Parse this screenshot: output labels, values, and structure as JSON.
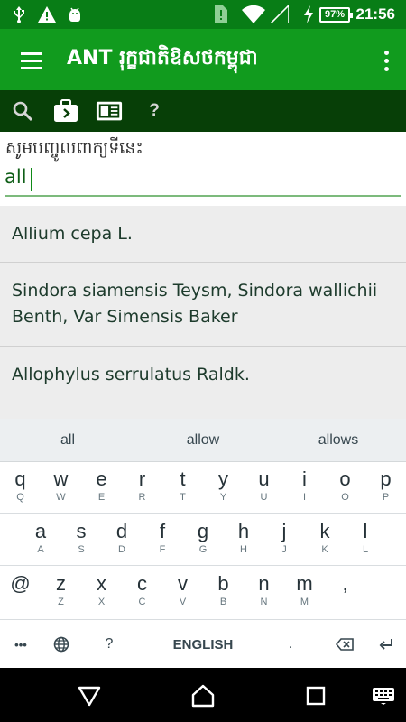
{
  "status_bar": {
    "icons": [
      "usb-icon",
      "warning-icon",
      "android-debug-icon",
      "sim-alert-icon",
      "wifi-icon",
      "cell-signal-icon",
      "charging-icon"
    ],
    "battery": "97%",
    "time": "21:56"
  },
  "app_bar": {
    "title": "ANT រុក្ខជាតិឱសថកម្ពុជា",
    "menu_icon": "hamburger-menu-icon",
    "overflow_icon": "more-vertical-icon"
  },
  "toolbar": {
    "items": [
      "search-icon",
      "briefcase-icon",
      "book-icon"
    ],
    "help_label": "?"
  },
  "search": {
    "prompt": "សូមបញ្ចូលពាក្យទីនេះ",
    "value": "all"
  },
  "results": [
    "Allium cepa L.",
    "Sindora siamensis Teysm, Sindora wallichii Benth, Var Simensis Baker",
    "Allophylus serrulatus Raldk."
  ],
  "keyboard": {
    "suggestions": [
      "all",
      "allow",
      "allows"
    ],
    "rows": [
      [
        [
          "q",
          "Q"
        ],
        [
          "w",
          "W"
        ],
        [
          "e",
          "E"
        ],
        [
          "r",
          "R"
        ],
        [
          "t",
          "T"
        ],
        [
          "y",
          "Y"
        ],
        [
          "u",
          "U"
        ],
        [
          "i",
          "I"
        ],
        [
          "o",
          "O"
        ],
        [
          "p",
          "P"
        ]
      ],
      [
        [
          "a",
          "A"
        ],
        [
          "s",
          "S"
        ],
        [
          "d",
          "D"
        ],
        [
          "f",
          "F"
        ],
        [
          "g",
          "G"
        ],
        [
          "h",
          "H"
        ],
        [
          "j",
          "J"
        ],
        [
          "k",
          "K"
        ],
        [
          "l",
          "L"
        ]
      ],
      [
        [
          "@",
          ""
        ],
        [
          "z",
          "Z"
        ],
        [
          "x",
          "X"
        ],
        [
          "c",
          "C"
        ],
        [
          "v",
          "V"
        ],
        [
          "b",
          "B"
        ],
        [
          "n",
          "N"
        ],
        [
          "m",
          "M"
        ],
        [
          ",",
          ""
        ]
      ]
    ],
    "bottom": {
      "more": "•••",
      "globe_icon": "globe-icon",
      "question": "?",
      "space": "ENGLISH",
      "period": ".",
      "backspace_icon": "backspace-icon",
      "enter_icon": "enter-icon"
    }
  },
  "nav_bar": [
    "back-triangle-icon",
    "home-icon",
    "recents-square-icon",
    "keyboard-icon"
  ],
  "colors": {
    "status_bar": "#087d16",
    "app_bar": "#119b1e",
    "toolbar": "#073f07",
    "accent": "#0f5e17"
  }
}
